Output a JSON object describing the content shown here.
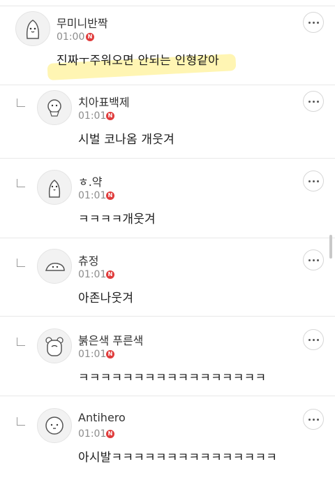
{
  "comments": [
    {
      "name": "무미니반짝",
      "time": "01:00",
      "badge": "N",
      "text": "진짜ㅜ주워오면 안되는 인형같아",
      "avatar": "blob-character-avatar",
      "is_reply": false
    },
    {
      "name": "치아표백제",
      "time": "01:01",
      "badge": "N",
      "text": "시벌 코나옴 개웃겨",
      "avatar": "fluffy-character-avatar",
      "is_reply": true
    },
    {
      "name": "ㅎ.약",
      "time": "01:01",
      "badge": "N",
      "text": "ㅋㅋㅋㅋ개웃겨",
      "avatar": "penguin-character-avatar",
      "is_reply": true
    },
    {
      "name": "츄정",
      "time": "01:01",
      "badge": "N",
      "text": "아존나웃겨",
      "avatar": "dinosaur-character-avatar",
      "is_reply": true
    },
    {
      "name": "붉은색 푸른색",
      "time": "01:01",
      "badge": "N",
      "text": "ㅋㅋㅋㅋㅋㅋㅋㅋㅋㅋㅋㅋㅋㅋㅋㅋㅋ",
      "avatar": "bear-character-avatar",
      "is_reply": true
    },
    {
      "name": "Antihero",
      "time": "01:01",
      "badge": "N",
      "text": "아시발ㅋㅋㅋㅋㅋㅋㅋㅋㅋㅋㅋㅋㅋㅋㅋ",
      "avatar": "round-character-avatar",
      "is_reply": true
    }
  ],
  "colors": {
    "badge": "#e03c3c",
    "highlight": "#fff3a6"
  }
}
